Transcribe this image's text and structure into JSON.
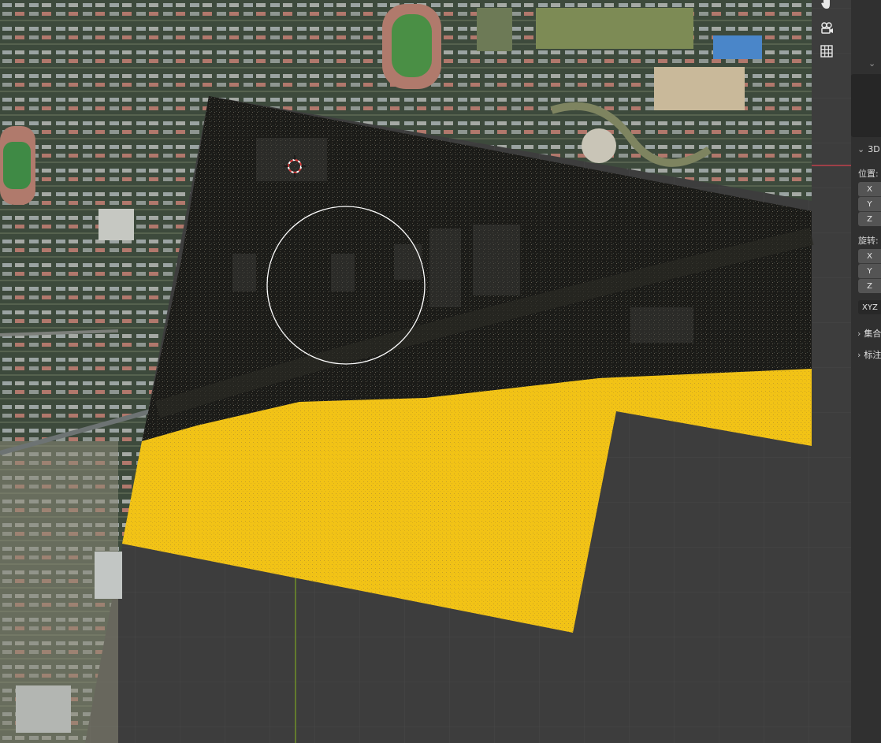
{
  "viewport": {
    "tools": {
      "pan_icon": "hand-icon",
      "camera_icon": "camera-icon",
      "ortho_icon": "grid-icon"
    },
    "colors": {
      "background": "#3d3d3d",
      "grid": "#4a4a4a",
      "y_axis": "#6f8f2a",
      "x_axis_marker": "#c0414c",
      "pointcloud_dark": "#1c1b18",
      "pointcloud_selected": "#f5c518",
      "brush_circle": "#ffffff"
    }
  },
  "sidebar": {
    "panel_3d": {
      "label": "3D"
    },
    "location": {
      "label": "位置:",
      "axes": [
        "X",
        "Y",
        "Z"
      ]
    },
    "rotation": {
      "label": "旋转:",
      "axes": [
        "X",
        "Y",
        "Z"
      ],
      "mode": "XYZ"
    },
    "collections": {
      "label": "集合"
    },
    "annotations": {
      "label": "标注"
    }
  }
}
